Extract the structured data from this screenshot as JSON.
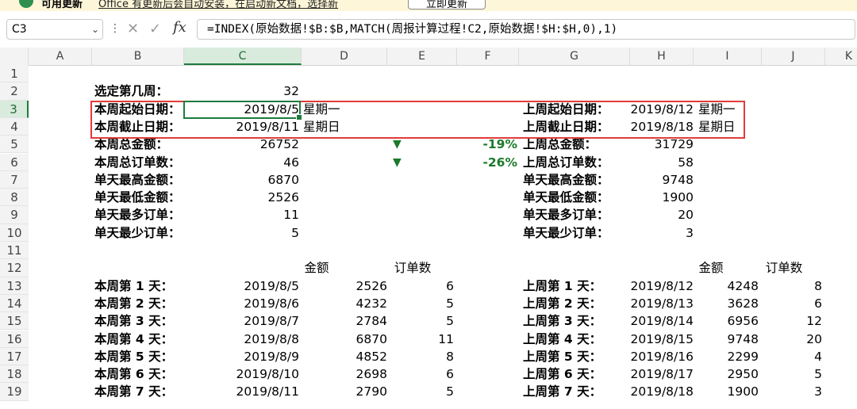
{
  "infobar": {
    "title": "可用更新",
    "message": "Office 有更新后会自动安装，在启动新文档，选择新",
    "button": "立即更新"
  },
  "namebox": {
    "value": "C3"
  },
  "formula": {
    "fx": "fx",
    "value": "=INDEX(原始数据!$B:$B,MATCH(周报计算过程!C2,原始数据!$H:$H,0),1)"
  },
  "columns": [
    "A",
    "B",
    "C",
    "D",
    "E",
    "F",
    "G",
    "H",
    "I",
    "J",
    "K"
  ],
  "rows": [
    "1",
    "2",
    "3",
    "4",
    "5",
    "6",
    "7",
    "8",
    "9",
    "10",
    "11",
    "12",
    "13",
    "14",
    "15",
    "16",
    "17",
    "18",
    "19"
  ],
  "summary": {
    "week_select_label": "选定第几周：",
    "week_select_value": "32",
    "this_start_label": "本周起始日期：",
    "this_start_date": "2019/8/5",
    "this_start_weekday": "星期一",
    "this_end_label": "本周截止日期：",
    "this_end_date": "2019/8/11",
    "this_end_weekday": "星期日",
    "last_start_label": "上周起始日期：",
    "last_start_date": "2019/8/12",
    "last_start_weekday": "星期一",
    "last_end_label": "上周截止日期：",
    "last_end_date": "2019/8/18",
    "last_end_weekday": "星期日",
    "this_total_amount_label": "本周总金额：",
    "this_total_amount": "26752",
    "amount_change": "-19%",
    "this_total_orders_label": "本周总订单数：",
    "this_total_orders": "46",
    "orders_change": "-26%",
    "down_arrow": "▼",
    "last_total_amount_label": "上周总金额：",
    "last_total_amount": "31729",
    "last_total_orders_label": "上周总订单数：",
    "last_total_orders": "58",
    "this_max_amount_label": "单天最高金额：",
    "this_max_amount": "6870",
    "this_min_amount_label": "单天最低金额：",
    "this_min_amount": "2526",
    "this_max_orders_label": "单天最多订单：",
    "this_max_orders": "11",
    "this_min_orders_label": "单天最少订单：",
    "this_min_orders": "5",
    "last_max_amount_label": "单天最高金额：",
    "last_max_amount": "9748",
    "last_min_amount_label": "单天最低金额：",
    "last_min_amount": "1900",
    "last_max_orders_label": "单天最多订单：",
    "last_max_orders": "20",
    "last_min_orders_label": "单天最少订单：",
    "last_min_orders": "3"
  },
  "daily": {
    "amount_header": "金额",
    "orders_header": "订单数",
    "this_week": [
      {
        "label": "本周第 1 天：",
        "date": "2019/8/5",
        "amount": "2526",
        "orders": "6"
      },
      {
        "label": "本周第 2 天：",
        "date": "2019/8/6",
        "amount": "4232",
        "orders": "5"
      },
      {
        "label": "本周第 3 天：",
        "date": "2019/8/7",
        "amount": "2784",
        "orders": "5"
      },
      {
        "label": "本周第 4 天：",
        "date": "2019/8/8",
        "amount": "6870",
        "orders": "11"
      },
      {
        "label": "本周第 5 天：",
        "date": "2019/8/9",
        "amount": "4852",
        "orders": "8"
      },
      {
        "label": "本周第 6 天：",
        "date": "2019/8/10",
        "amount": "2698",
        "orders": "6"
      },
      {
        "label": "本周第 7 天：",
        "date": "2019/8/11",
        "amount": "2790",
        "orders": "5"
      }
    ],
    "last_week": [
      {
        "label": "上周第 1 天：",
        "date": "2019/8/12",
        "amount": "4248",
        "orders": "8"
      },
      {
        "label": "上周第 2 天：",
        "date": "2019/8/13",
        "amount": "3628",
        "orders": "6"
      },
      {
        "label": "上周第 3 天：",
        "date": "2019/8/14",
        "amount": "6956",
        "orders": "12"
      },
      {
        "label": "上周第 4 天：",
        "date": "2019/8/15",
        "amount": "9748",
        "orders": "20"
      },
      {
        "label": "上周第 5 天：",
        "date": "2019/8/16",
        "amount": "2299",
        "orders": "4"
      },
      {
        "label": "上周第 6 天：",
        "date": "2019/8/17",
        "amount": "2950",
        "orders": "5"
      },
      {
        "label": "上周第 7 天：",
        "date": "2019/8/18",
        "amount": "1900",
        "orders": "3"
      }
    ]
  },
  "colors": {
    "selection": "#1e7b3e",
    "highlight_box": "#e23b3b",
    "down_indicator": "#1b7a2b"
  }
}
